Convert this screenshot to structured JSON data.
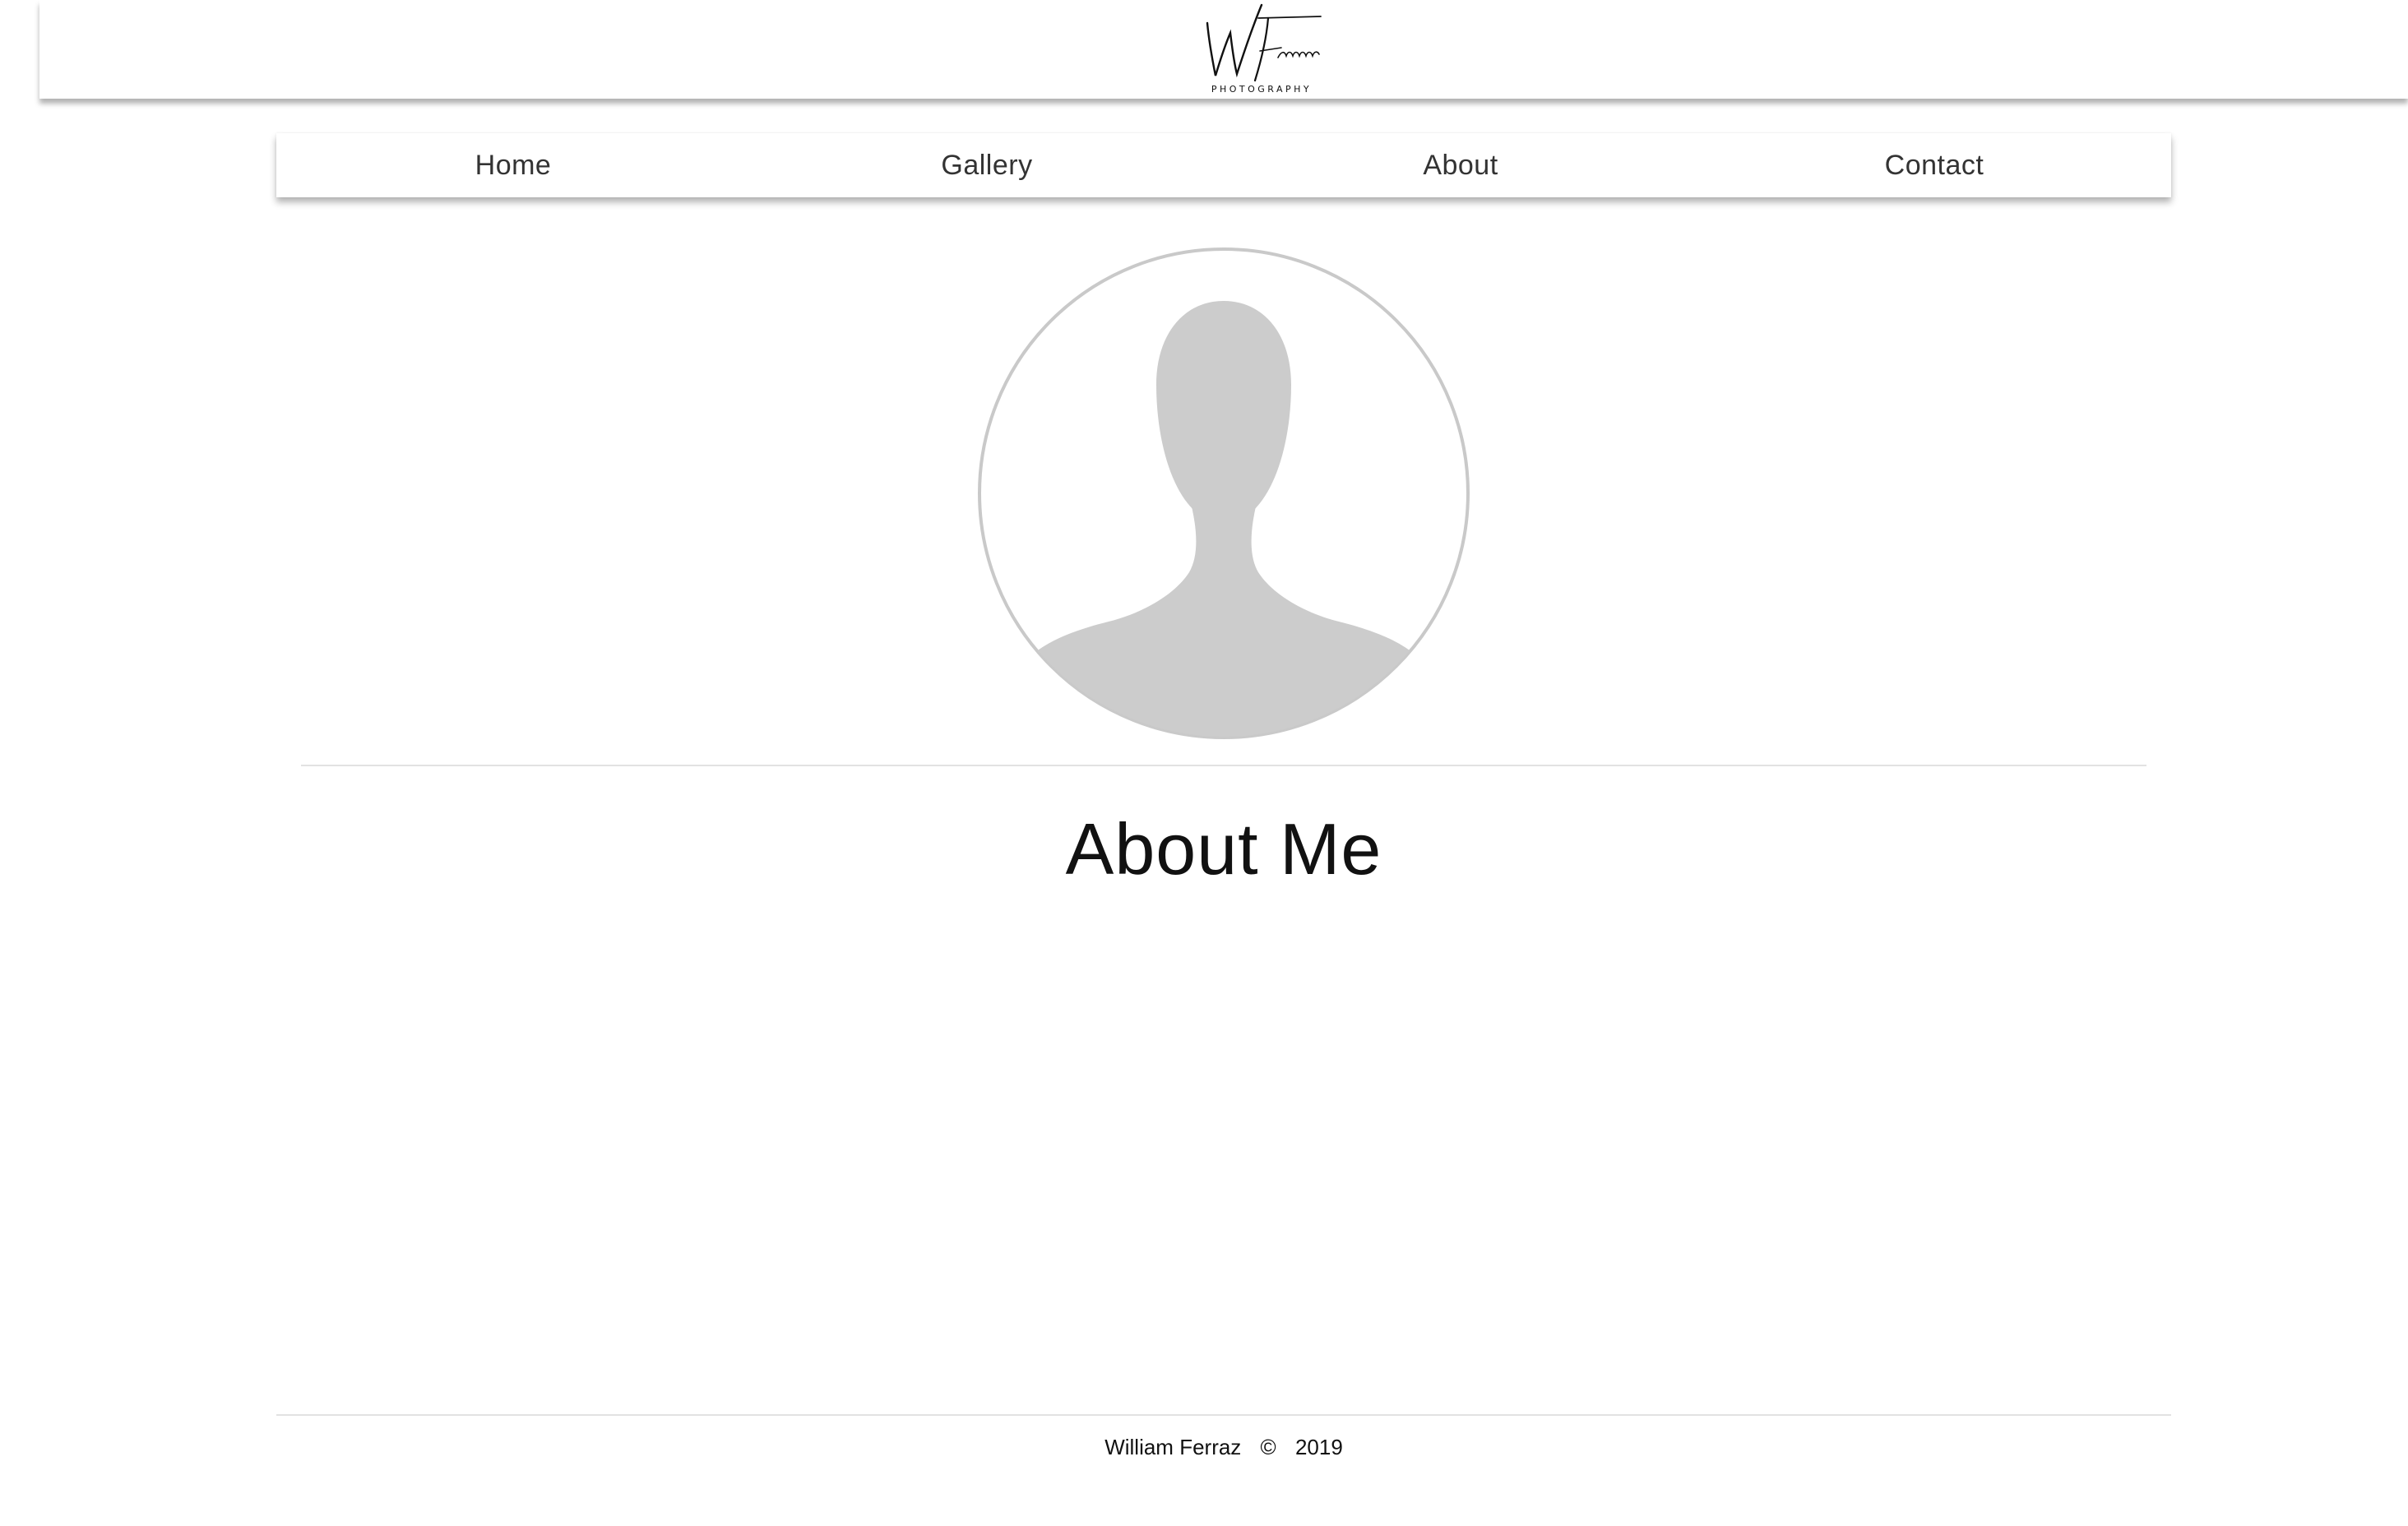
{
  "header": {
    "logo": {
      "script_initials": "W",
      "script_name": "Ferraz",
      "tagline": "PHOTOGRAPHY"
    }
  },
  "nav": {
    "items": [
      {
        "label": "Home"
      },
      {
        "label": "Gallery"
      },
      {
        "label": "About"
      },
      {
        "label": "Contact"
      }
    ]
  },
  "profile": {
    "avatar_icon": "person-silhouette-icon",
    "avatar_color": "#cccccc",
    "ring_color": "#c9c9c9"
  },
  "main": {
    "title": "About Me"
  },
  "footer": {
    "name": "William Ferraz",
    "copyright_symbol": "©",
    "year": "2019"
  }
}
